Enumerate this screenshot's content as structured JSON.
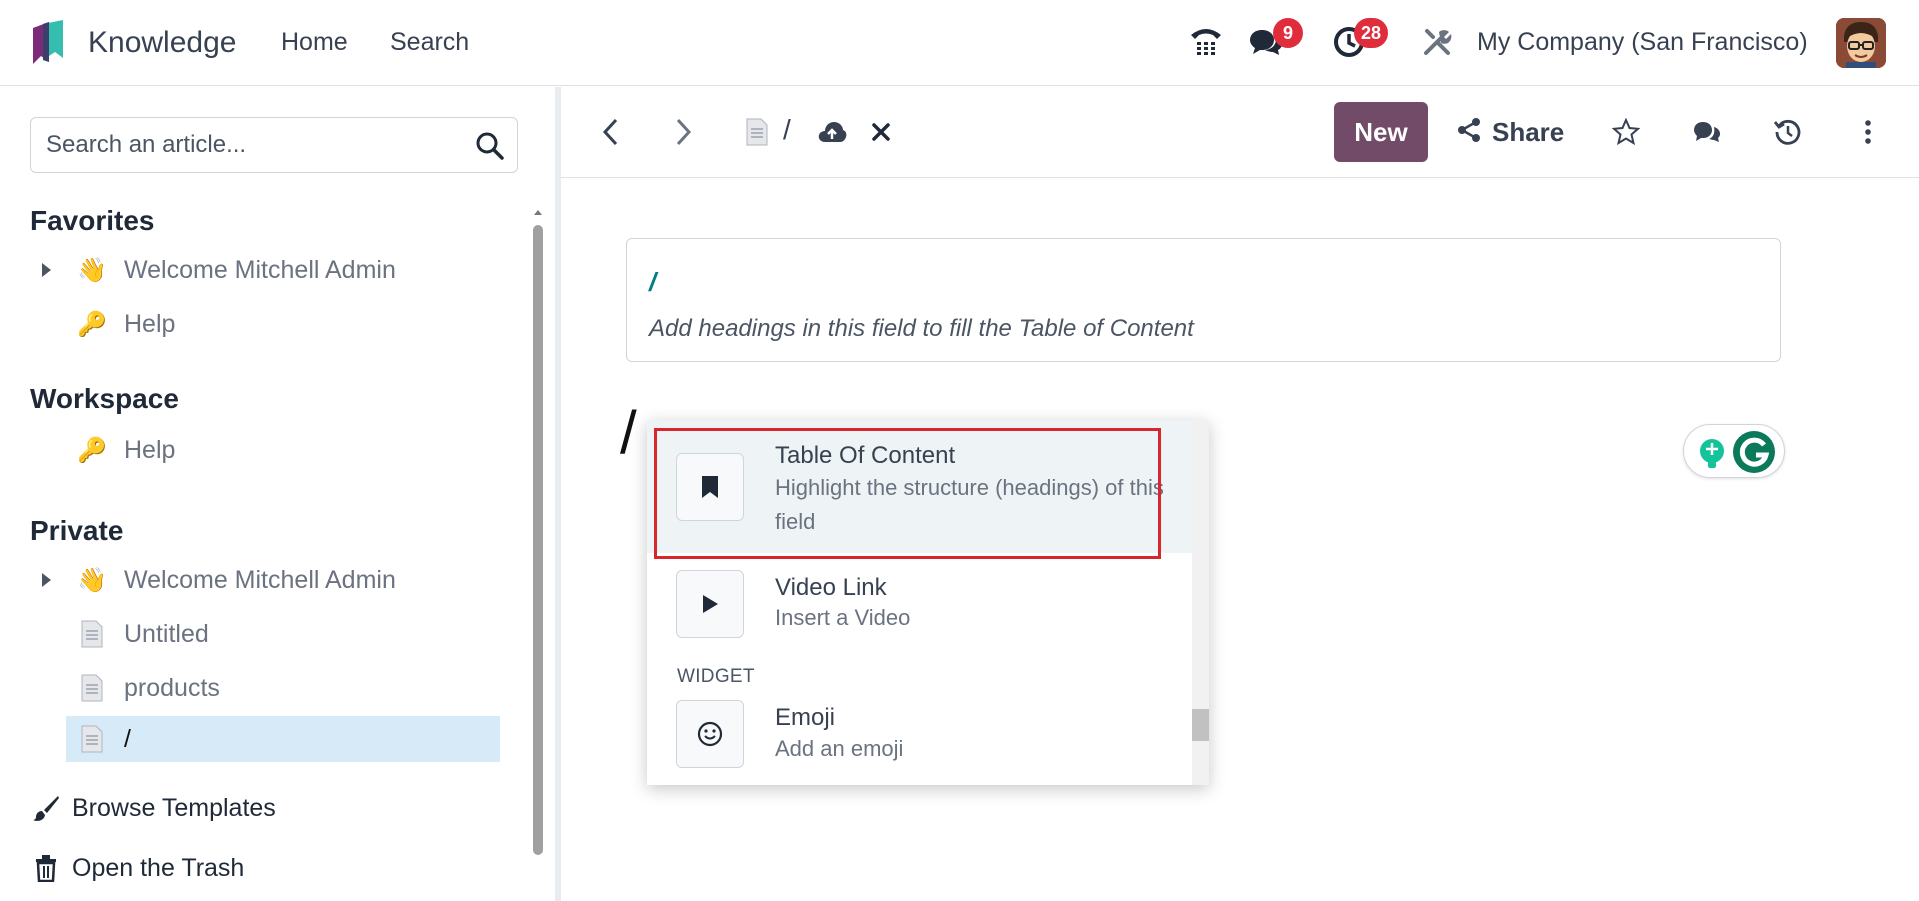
{
  "app": {
    "name": "Knowledge",
    "menu": [
      "Home",
      "Search"
    ]
  },
  "systray": {
    "phone_icon": "phone-icon",
    "messages_badge": "9",
    "activities_badge": "28",
    "company": "My Company (San Francisco)"
  },
  "sidebar": {
    "search_placeholder": "Search an article...",
    "favorites_title": "Favorites",
    "favorites": [
      {
        "icon": "👋",
        "label": "Welcome Mitchell Admin",
        "has_children": true
      },
      {
        "icon": "🔑",
        "label": "Help",
        "has_children": false
      }
    ],
    "workspace_title": "Workspace",
    "workspace": [
      {
        "icon": "🔑",
        "label": "Help",
        "has_children": false
      }
    ],
    "private_title": "Private",
    "private": [
      {
        "icon": "👋",
        "label": "Welcome Mitchell Admin",
        "has_children": true
      },
      {
        "icon": "page-icon",
        "label": "Untitled",
        "has_children": false
      },
      {
        "icon": "page-icon",
        "label": "products",
        "has_children": false
      },
      {
        "icon": "page-icon",
        "label": "/",
        "has_children": false,
        "active": true
      }
    ],
    "browse_templates": "Browse Templates",
    "open_trash": "Open the Trash"
  },
  "control_panel": {
    "breadcrumb": "/",
    "new_label": "New",
    "share_label": "Share"
  },
  "article": {
    "toc_title": "/",
    "toc_hint": "Add headings in this field to fill the Table of Content",
    "body_text": "/"
  },
  "palette": {
    "items": [
      {
        "title": "Table Of Content",
        "description": "Highlight the structure (headings) of this field",
        "icon": "bookmark-icon",
        "active": true
      },
      {
        "title": "Video Link",
        "description": "Insert a Video",
        "icon": "play-icon"
      }
    ],
    "category": "WIDGET",
    "widget_items": [
      {
        "title": "Emoji",
        "description": "Add an emoji",
        "icon": "smiley-icon"
      }
    ]
  },
  "colors": {
    "brand": "#714b67",
    "badge": "#e02d3c",
    "active_row": "#d6ebf7",
    "highlight": "#d6262e",
    "toc_accent": "#017e84"
  }
}
